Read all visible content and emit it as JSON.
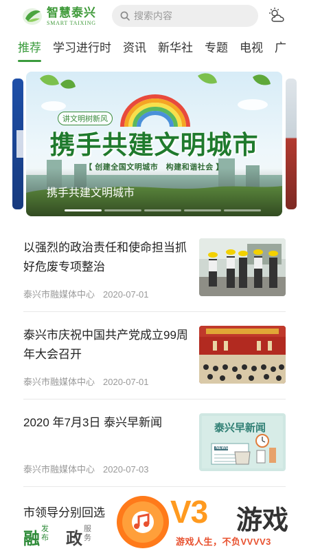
{
  "header": {
    "logo_cn": "智慧泰兴",
    "logo_en": "SMART TAIXING",
    "search_placeholder": "搜索内容",
    "weather_icon": "partly-cloudy-icon"
  },
  "tabs": [
    {
      "label": "推荐",
      "active": true
    },
    {
      "label": "学习进行时",
      "active": false
    },
    {
      "label": "资讯",
      "active": false
    },
    {
      "label": "新华社",
      "active": false
    },
    {
      "label": "专题",
      "active": false
    },
    {
      "label": "电视",
      "active": false
    },
    {
      "label": "广",
      "active": false
    }
  ],
  "banner": {
    "slogan_small": "讲文明树新风",
    "headline": "携手共建文明城市",
    "subline": "【 创建全国文明城市　构建和谐社会 】",
    "caption": "携手共建文明城市",
    "slide_count": 5,
    "active_slide": 1
  },
  "news": [
    {
      "title": "以强烈的政治责任和使命担当抓好危废专项整治",
      "source": "泰兴市融媒体中心",
      "date": "2020-07-01"
    },
    {
      "title": "泰兴市庆祝中国共产党成立99周年大会召开",
      "source": "泰兴市融媒体中心",
      "date": "2020-07-01"
    },
    {
      "title": "2020 年7月3日 泰兴早新闻",
      "source": "泰兴市融媒体中心",
      "date": "2020-07-03",
      "thumb_text": "泰兴早新闻",
      "thumb_paper": "NEWS"
    }
  ],
  "bottom": {
    "title": "市领导分别回选",
    "logo1_big": "融",
    "logo1_small": "发布",
    "logo2_big": "政",
    "logo2_small": "服务"
  },
  "watermark": {
    "brand": "V3",
    "brand_cn": "游戏",
    "slogan": "游戏人生，不负VVVV3"
  },
  "colors": {
    "accent": "#3a9b3c",
    "watermark_orange": "#ff9a1f",
    "watermark_red": "#e8512f"
  }
}
